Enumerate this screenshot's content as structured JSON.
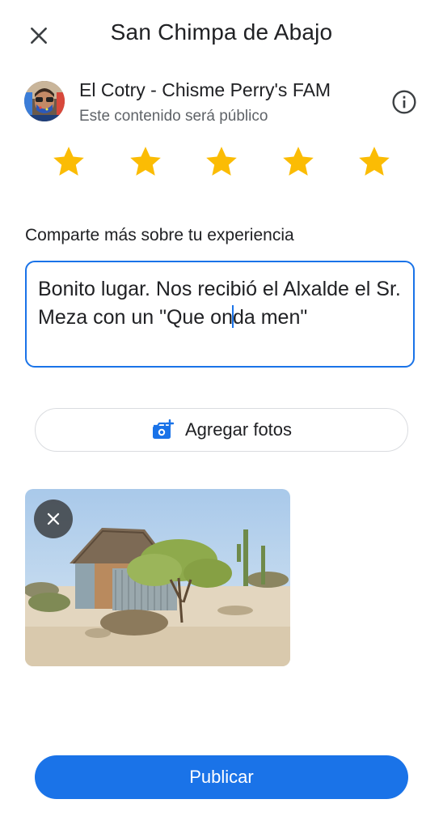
{
  "header": {
    "title": "San Chimpa de Abajo",
    "close_icon": "close-icon"
  },
  "author": {
    "name": "El Cotry - Chisme Perry's FAM",
    "visibility": "Este contenido será público",
    "info_icon": "info-icon"
  },
  "rating": {
    "value": 5,
    "max": 5,
    "color": "#fbbc04"
  },
  "review": {
    "label": "Comparte más sobre tu experiencia",
    "text_before_cursor": "Bonito lugar. Nos recibió el Alxalde el Sr. Meza con un \"Que on",
    "text_after_cursor": "da men\""
  },
  "photos": {
    "add_label": "Agregar fotos",
    "add_icon": "add-photo-icon"
  },
  "publish": {
    "label": "Publicar"
  },
  "colors": {
    "accent": "#1a73e8",
    "star": "#fbbc04",
    "secondary_text": "#5f6368",
    "outline": "#dadce0"
  }
}
